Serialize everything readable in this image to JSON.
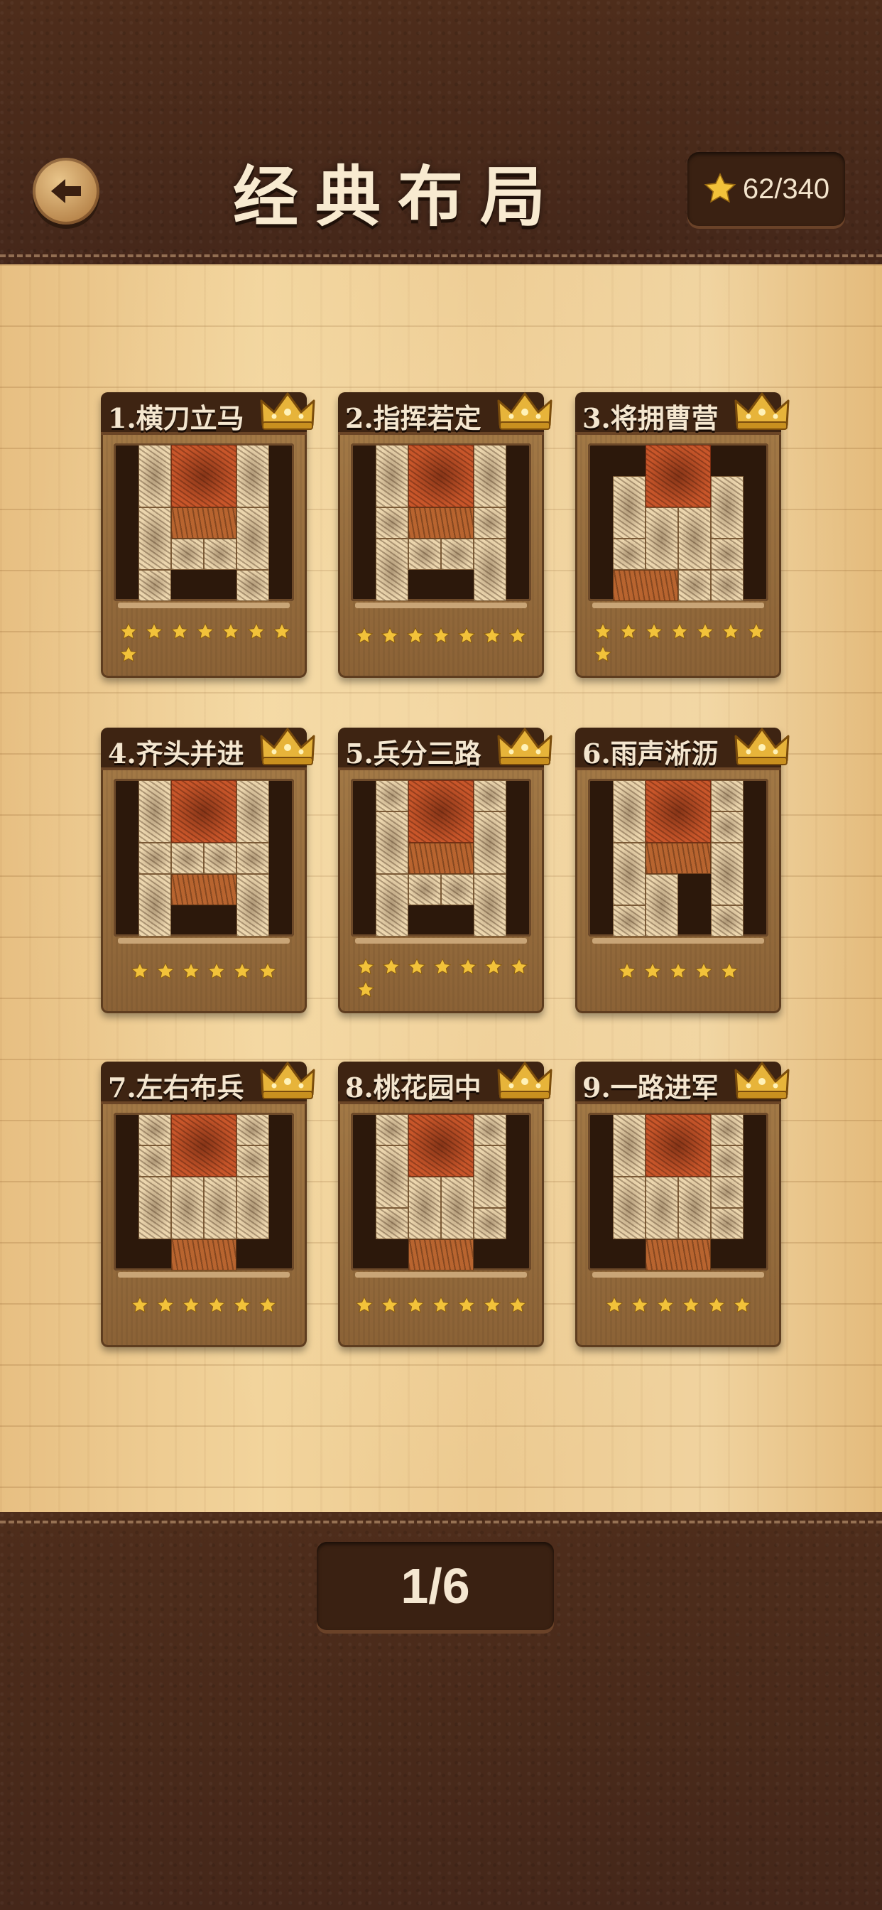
{
  "header": {
    "title": "经典布局",
    "back_icon": "back-arrow-icon",
    "star_total": "62/340"
  },
  "levels": [
    {
      "title": "1.横刀立马",
      "stars": 8,
      "crown": true
    },
    {
      "title": "2.指挥若定",
      "stars": 7,
      "crown": true
    },
    {
      "title": "3.将拥曹营",
      "stars": 8,
      "crown": true
    },
    {
      "title": "4.齐头并进",
      "stars": 6,
      "crown": true
    },
    {
      "title": "5.兵分三路",
      "stars": 8,
      "crown": true
    },
    {
      "title": "6.雨声淅沥",
      "stars": 5,
      "crown": true
    },
    {
      "title": "7.左右布兵",
      "stars": 6,
      "crown": true
    },
    {
      "title": "8.桃花园中",
      "stars": 7,
      "crown": true
    },
    {
      "title": "9.一路进军",
      "stars": 6,
      "crown": true
    }
  ],
  "pagination": {
    "label": "1/6"
  },
  "colors": {
    "star": "#f2c23a",
    "leather": "#4a2c1a",
    "wood": "#ecc98f",
    "boss_tile": "#c8562a"
  }
}
